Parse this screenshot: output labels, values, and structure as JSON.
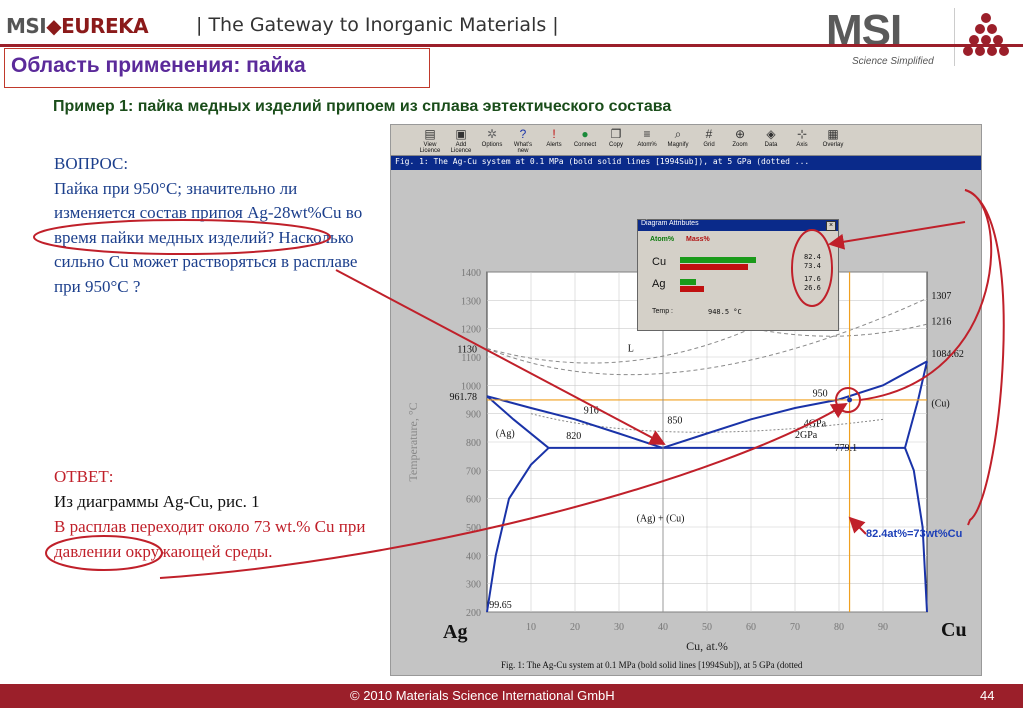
{
  "header": {
    "logo_msi": "MSI",
    "logo_eureka": "EUREKA",
    "tagline": "| The Gateway to Inorganic Materials |",
    "brand_big": "MSI",
    "brand_sub": "Science Simplified"
  },
  "title": "Область применения: пайка",
  "example": "Пример 1:  пайка медных изделий припоем из сплава эвтектического состава",
  "question": {
    "head": "ВОПРОС:",
    "body": "Пайка при 950°С; значительно ли изменяется состав припоя Ag-28wt%Cu во время пайки медных изделий? Насколько сильно Cu может растворяться в расплаве при 950°С ?"
  },
  "answer": {
    "head": "ОТВЕТ:",
    "ref": "Из диаграммы  Ag-Cu, рис. 1",
    "body": "В расплав переходит около 73 wt.% Cu при  давлении окружающей среды."
  },
  "toolbar": [
    {
      "label": "View Licence",
      "icon": "licence-icon"
    },
    {
      "label": "Add Licence",
      "icon": "add-licence-icon"
    },
    {
      "label": "Options",
      "icon": "options-icon"
    },
    {
      "label": "What's new",
      "icon": "question-icon"
    },
    {
      "label": "Alerts",
      "icon": "alert-icon"
    },
    {
      "label": "Connect",
      "icon": "globe-icon"
    },
    {
      "label": "Copy",
      "icon": "copy-icon"
    },
    {
      "label": "Atom%",
      "icon": "atom-icon"
    },
    {
      "label": "Magnify",
      "icon": "magnify-icon"
    },
    {
      "label": "Grid",
      "icon": "grid-icon"
    },
    {
      "label": "Zoom",
      "icon": "zoom-icon"
    },
    {
      "label": "Data",
      "icon": "data-icon"
    },
    {
      "label": "Axis",
      "icon": "axis-icon"
    },
    {
      "label": "Overlay",
      "icon": "overlay-icon"
    }
  ],
  "window_title": "Fig. 1: The Ag-Cu system at 0.1 MPa (bold solid lines [1994Sub]), at 5 GPa (dotted ...",
  "diagram_attributes": {
    "title": "Diagram Attributes",
    "col_atom": "Atom%",
    "col_mass": "Mass%",
    "rows": [
      {
        "el": "Cu",
        "atom": "82.4",
        "mass": "73.4",
        "atom_frac": 0.824,
        "mass_frac": 0.734
      },
      {
        "el": "Ag",
        "atom": "17.6",
        "mass": "26.6",
        "atom_frac": 0.176,
        "mass_frac": 0.266
      }
    ],
    "temp_label": "Temp :",
    "temp_value": "948.5 °C"
  },
  "chart_data": {
    "type": "line",
    "xlabel": "Cu, at.%",
    "ylabel": "Temperature, °C",
    "left_element": "Ag",
    "right_element": "Cu",
    "xlim": [
      0,
      100
    ],
    "ylim": [
      200,
      1400
    ],
    "x_ticks": [
      "10",
      "20",
      "30",
      "40",
      "50",
      "60",
      "70",
      "80",
      "90"
    ],
    "y_ticks": [
      "200",
      "300",
      "400",
      "500",
      "600",
      "700",
      "800",
      "900",
      "1000",
      "1100",
      "1200",
      "1300",
      "1400"
    ],
    "caption": "Fig. 1: The Ag-Cu system at 0.1 MPa (bold solid lines [1994Sub]), at 5 GPa (dotted",
    "labels": {
      "liquid": "L",
      "ag_phase": "(Ag)",
      "cu_phase": "(Cu)",
      "two_phase": "(Ag) + (Cu)",
      "p4": "4GPa",
      "p2": "2GPa"
    },
    "temperatures": {
      "t1130": "1130",
      "t96178": "961.78",
      "t916": "916",
      "t850": "850",
      "t820": "820",
      "t950": "950",
      "t7791": "779.1",
      "t1307": "1307",
      "t1216": "1216",
      "t108462": "1084.62",
      "t9965": "99.65"
    },
    "series": [
      {
        "name": "liquidus-ag",
        "x": [
          0,
          10,
          20,
          30,
          39.9
        ],
        "y": [
          961.78,
          920,
          880,
          830,
          779.1
        ]
      },
      {
        "name": "liquidus-cu",
        "x": [
          39.9,
          50,
          60,
          70,
          80,
          90,
          100
        ],
        "y": [
          779.1,
          830,
          880,
          920,
          950,
          1000,
          1084.62
        ]
      },
      {
        "name": "eutectic",
        "x": [
          14,
          95
        ],
        "y": [
          779.1,
          779.1
        ]
      },
      {
        "name": "solvus-ag",
        "x": [
          0,
          2,
          5,
          10,
          14
        ],
        "y": [
          200,
          400,
          600,
          720,
          779.1
        ]
      },
      {
        "name": "solvus-cu",
        "x": [
          95,
          97,
          99,
          100
        ],
        "y": [
          779.1,
          700,
          500,
          200
        ]
      },
      {
        "name": "solidus-ag",
        "x": [
          0,
          6,
          14
        ],
        "y": [
          961.78,
          880,
          779.1
        ]
      },
      {
        "name": "solidus-cu",
        "x": [
          95,
          98,
          100
        ],
        "y": [
          779.1,
          950,
          1084.62
        ]
      }
    ],
    "guides": {
      "x": 82.4,
      "y": 948.5
    }
  },
  "callout": "82.4at%=73wt%Cu",
  "footer": {
    "copyright": "© 2010 Materials Science International GmbH",
    "page": "44"
  },
  "colors": {
    "brand_red": "#9b1f2a",
    "title_purple": "#5b2a9a",
    "question_blue": "#1c3f8c",
    "answer_red": "#c0202a",
    "phase_line": "#1a33a8",
    "guide_orange": "#f0a020",
    "arrow_red": "#c0202a"
  }
}
